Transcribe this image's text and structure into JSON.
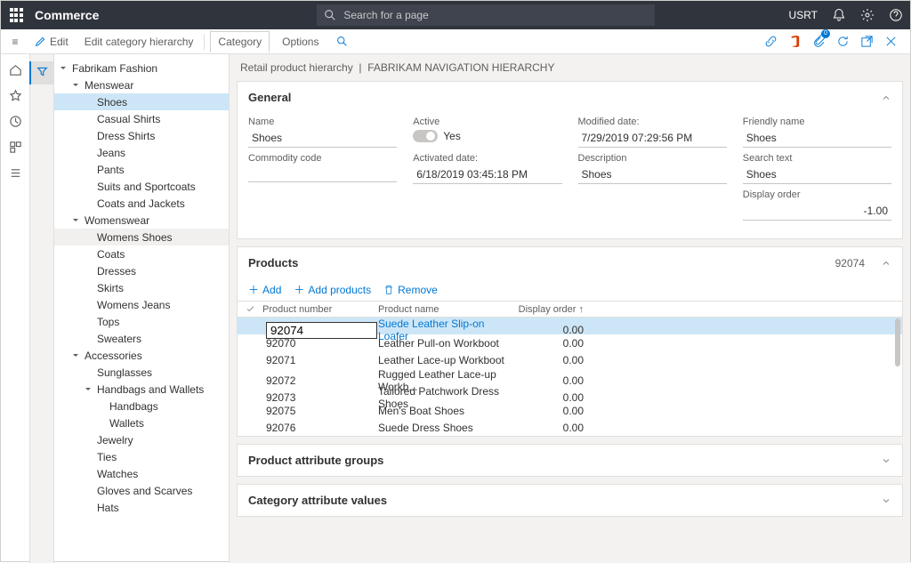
{
  "header": {
    "brand": "Commerce",
    "search_placeholder": "Search for a page",
    "user": "USRT"
  },
  "actionbar": {
    "edit": "Edit",
    "edit_hierarchy": "Edit category hierarchy",
    "tabs": [
      "Category",
      "Options"
    ]
  },
  "breadcrumb": {
    "a": "Retail product hierarchy",
    "sep": "|",
    "b": "FABRIKAM NAVIGATION HIERARCHY"
  },
  "tree": [
    {
      "l": 0,
      "exp": true,
      "label": "Fabrikam Fashion"
    },
    {
      "l": 1,
      "exp": true,
      "label": "Menswear"
    },
    {
      "l": 2,
      "label": "Shoes",
      "sel": true
    },
    {
      "l": 2,
      "label": "Casual Shirts"
    },
    {
      "l": 2,
      "label": "Dress Shirts"
    },
    {
      "l": 2,
      "label": "Jeans"
    },
    {
      "l": 2,
      "label": "Pants"
    },
    {
      "l": 2,
      "label": "Suits and Sportcoats"
    },
    {
      "l": 2,
      "label": "Coats and Jackets"
    },
    {
      "l": 1,
      "exp": true,
      "label": "Womenswear"
    },
    {
      "l": 2,
      "label": "Womens Shoes",
      "hov": true
    },
    {
      "l": 2,
      "label": "Coats"
    },
    {
      "l": 2,
      "label": "Dresses"
    },
    {
      "l": 2,
      "label": "Skirts"
    },
    {
      "l": 2,
      "label": "Womens Jeans"
    },
    {
      "l": 2,
      "label": "Tops"
    },
    {
      "l": 2,
      "label": "Sweaters"
    },
    {
      "l": 1,
      "exp": true,
      "label": "Accessories"
    },
    {
      "l": 2,
      "label": "Sunglasses"
    },
    {
      "l": 2,
      "exp": true,
      "label": "Handbags and Wallets"
    },
    {
      "l": 3,
      "label": "Handbags"
    },
    {
      "l": 3,
      "label": "Wallets"
    },
    {
      "l": 2,
      "label": "Jewelry"
    },
    {
      "l": 2,
      "label": "Ties"
    },
    {
      "l": 2,
      "label": "Watches"
    },
    {
      "l": 2,
      "label": "Gloves and Scarves"
    },
    {
      "l": 2,
      "label": "Hats"
    }
  ],
  "general": {
    "title": "General",
    "name_label": "Name",
    "name": "Shoes",
    "commodity_label": "Commodity code",
    "commodity": "",
    "active_label": "Active",
    "active_text": "Yes",
    "activated_label": "Activated date:",
    "activated": "6/18/2019 03:45:18 PM",
    "modified_label": "Modified date:",
    "modified": "7/29/2019 07:29:56 PM",
    "description_label": "Description",
    "description": "Shoes",
    "friendly_label": "Friendly name",
    "friendly": "Shoes",
    "search_label": "Search text",
    "search": "Shoes",
    "display_label": "Display order",
    "display": "-1.00"
  },
  "products": {
    "title": "Products",
    "count": "92074",
    "tools": {
      "add": "Add",
      "add_products": "Add products",
      "remove": "Remove"
    },
    "columns": {
      "num": "Product number",
      "name": "Product name",
      "dord": "Display order ↑"
    },
    "rows": [
      {
        "num": "92074",
        "name": "Suede Leather Slip-on Loafer",
        "dord": "0.00",
        "sel": true
      },
      {
        "num": "92070",
        "name": "Leather  Pull-on Workboot",
        "dord": "0.00"
      },
      {
        "num": "92071",
        "name": "Leather Lace-up Workboot",
        "dord": "0.00"
      },
      {
        "num": "92072",
        "name": "Rugged Leather Lace-up Workb...",
        "dord": "0.00"
      },
      {
        "num": "92073",
        "name": "Tailored Patchwork Dress Shoes",
        "dord": "0.00"
      },
      {
        "num": "92075",
        "name": "Men's Boat Shoes",
        "dord": "0.00"
      },
      {
        "num": "92076",
        "name": "Suede Dress Shoes",
        "dord": "0.00"
      }
    ]
  },
  "panel_pag": "Product attribute groups",
  "panel_cav": "Category attribute values"
}
